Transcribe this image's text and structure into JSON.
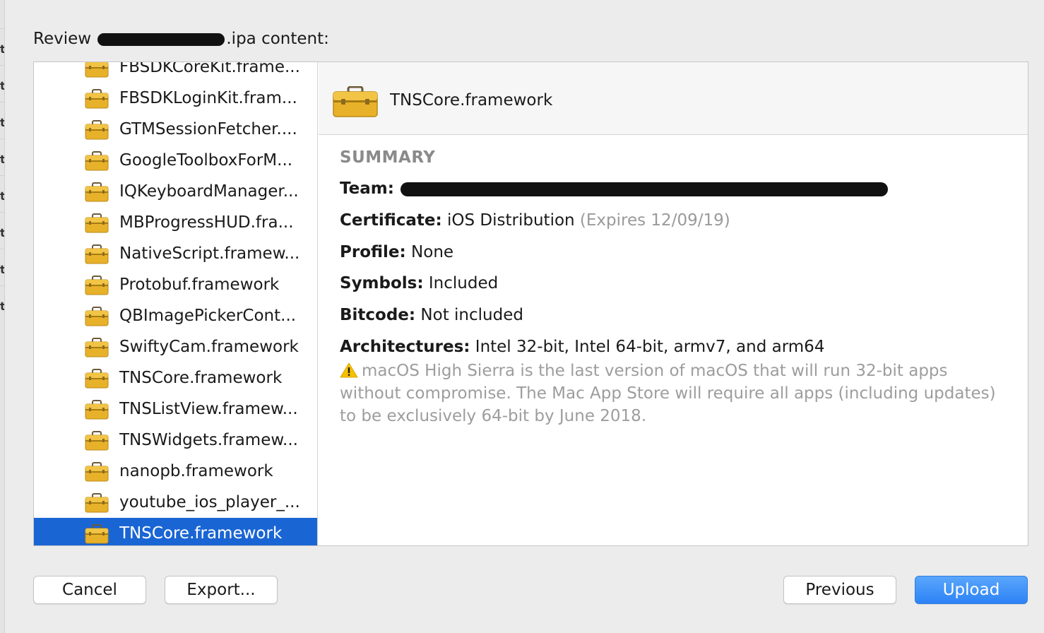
{
  "dialog": {
    "title_prefix": "Review",
    "title_suffix": ".ipa content:"
  },
  "sidebar": {
    "items": [
      {
        "label": "FBSDKCoreKit.frame..."
      },
      {
        "label": "FBSDKLoginKit.fram..."
      },
      {
        "label": "GTMSessionFetcher...."
      },
      {
        "label": "GoogleToolboxForM..."
      },
      {
        "label": "IQKeyboardManager..."
      },
      {
        "label": "MBProgressHUD.fra..."
      },
      {
        "label": "NativeScript.framew..."
      },
      {
        "label": "Protobuf.framework"
      },
      {
        "label": "QBImagePickerCont..."
      },
      {
        "label": "SwiftyCam.framework"
      },
      {
        "label": "TNSCore.framework"
      },
      {
        "label": "TNSListView.framew..."
      },
      {
        "label": "TNSWidgets.framew..."
      },
      {
        "label": "nanopb.framework"
      },
      {
        "label": "youtube_ios_player_..."
      },
      {
        "label": "TNSCore.framework"
      }
    ],
    "selected_index": 15,
    "icon": "toolbox-icon"
  },
  "detail": {
    "header_title": "TNSCore.framework",
    "summary_heading": "SUMMARY",
    "team_key": "Team:",
    "certificate_key": "Certificate:",
    "certificate_value": "iOS Distribution",
    "certificate_expiry": "(Expires 12/09/19)",
    "profile_key": "Profile:",
    "profile_value": "None",
    "symbols_key": "Symbols:",
    "symbols_value": "Included",
    "bitcode_key": "Bitcode:",
    "bitcode_value": "Not included",
    "architectures_key": "Architectures:",
    "architectures_value": "Intel 32-bit, Intel 64-bit, armv7, and arm64",
    "warning_text": "macOS High Sierra is the last version of macOS that will run 32-bit apps without compromise. The Mac App Store will require all apps (including updates) to be exclusively 64-bit by June 2018."
  },
  "buttons": {
    "cancel": "Cancel",
    "export": "Export...",
    "previous": "Previous",
    "upload": "Upload"
  },
  "colors": {
    "selection": "#1a65d4",
    "primary_button": "#2d83f6",
    "warning_icon": "#f5c000",
    "toolbox": "#e0a81f"
  }
}
